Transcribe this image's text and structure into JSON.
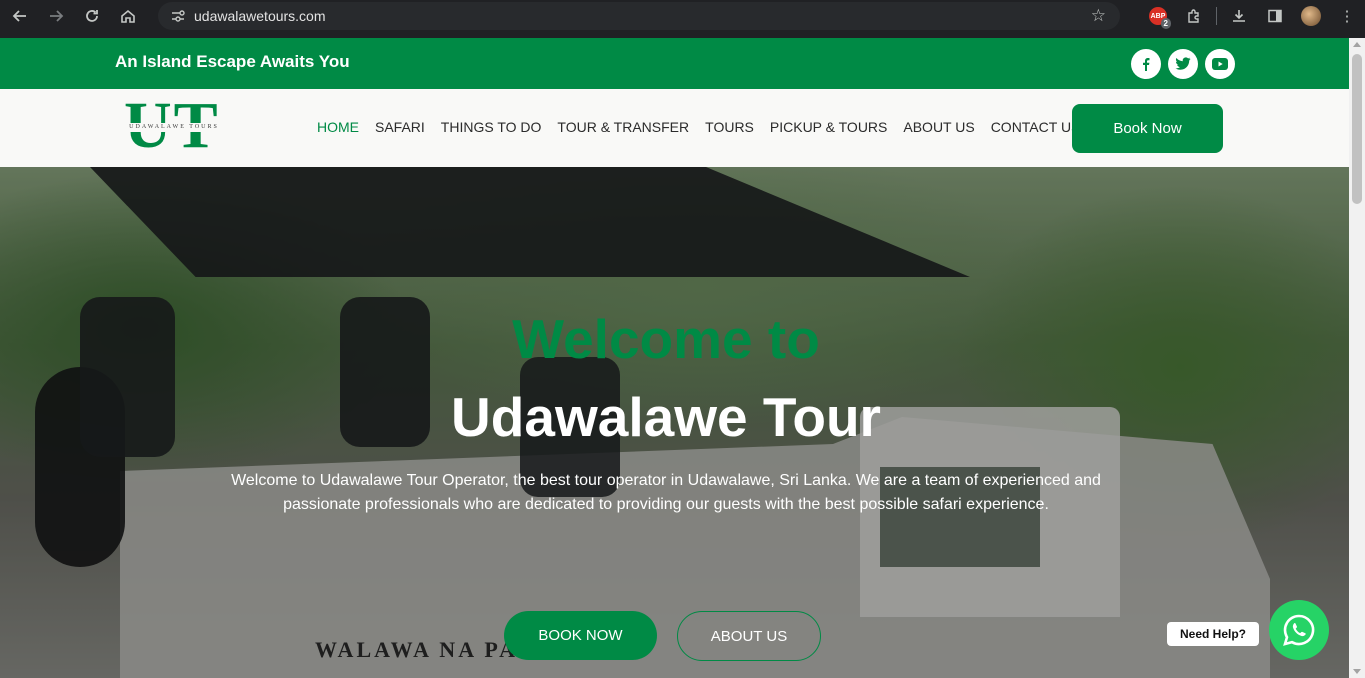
{
  "browser": {
    "url": "udawalawetours.com",
    "extension_badge": "ABP",
    "extension_count": "2"
  },
  "topbar": {
    "tagline": "An Island Escape Awaits You",
    "socials": [
      "facebook-icon",
      "twitter-icon",
      "youtube-icon"
    ]
  },
  "header": {
    "logo_letters": "UT",
    "logo_strap": "UDAWALAWE TOURS",
    "menu": [
      {
        "label": "HOME",
        "active": true
      },
      {
        "label": "SAFARI"
      },
      {
        "label": "THINGS TO DO"
      },
      {
        "label": "TOUR & TRANSFER"
      },
      {
        "label": "TOURS"
      },
      {
        "label": "PICKUP & TOURS"
      },
      {
        "label": "ABOUT US"
      },
      {
        "label": "CONTACT US"
      }
    ],
    "book_label": "Book Now"
  },
  "hero": {
    "title_line1": "Welcome to",
    "title_line2": "Udawalawe Tour",
    "description": "Welcome to Udawalawe Tour Operator, the best tour operator in Udawalawe, Sri Lanka. We are a team of experienced and passionate professionals who are dedicated to providing our guests with the best possible safari experience.",
    "book_button": "BOOK NOW",
    "about_button": "ABOUT US",
    "plate_text": "WALAWA NA     PARK"
  },
  "chat": {
    "help_label": "Need Help?"
  },
  "colors": {
    "brand_green": "#008a45",
    "whatsapp_green": "#26d366"
  }
}
